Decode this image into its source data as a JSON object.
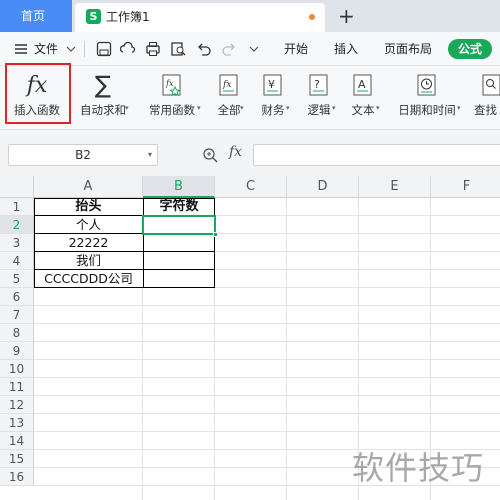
{
  "tabs": {
    "home_label": "首页",
    "doc_icon_letter": "S",
    "doc_title": "工作簿1",
    "new_tab_symbol": "+"
  },
  "menu": {
    "file_label": "文件",
    "items": [
      "开始",
      "插入",
      "页面布局",
      "公式"
    ]
  },
  "ribbon": {
    "buttons": [
      {
        "label": "插入函数",
        "icon": "fx-icon"
      },
      {
        "label": "自动求和",
        "icon": "sigma-icon"
      },
      {
        "label": "常用函数",
        "icon": "fx-star-icon"
      },
      {
        "label": "全部",
        "icon": "fx-doc-icon"
      },
      {
        "label": "财务",
        "icon": "yen-icon"
      },
      {
        "label": "逻辑",
        "icon": "question-doc-icon"
      },
      {
        "label": "文本",
        "icon": "text-a-icon"
      },
      {
        "label": "日期和时间",
        "icon": "clock-icon"
      },
      {
        "label": "查找",
        "icon": "search-icon"
      }
    ]
  },
  "formula_bar": {
    "cell_ref": "B2",
    "fx_label": "fx",
    "content": ""
  },
  "sheet": {
    "columns": [
      "A",
      "B",
      "C",
      "D",
      "E",
      "F"
    ],
    "selected_column": "B",
    "rows": [
      "1",
      "2",
      "3",
      "4",
      "5",
      "6",
      "7",
      "8",
      "9",
      "10",
      "11",
      "12",
      "13",
      "14",
      "15",
      "16"
    ],
    "selected_row": "2",
    "cells": {
      "A1": "抬头",
      "B1": "字符数",
      "A2": "个人",
      "A3": "22222",
      "A4": "我们",
      "A5": "CCCCDDD公司"
    }
  },
  "watermark": "软件技巧",
  "colors": {
    "accent_green": "#1aa85a",
    "tab_blue": "#4a8cf5",
    "highlight_red": "#d9262b"
  }
}
